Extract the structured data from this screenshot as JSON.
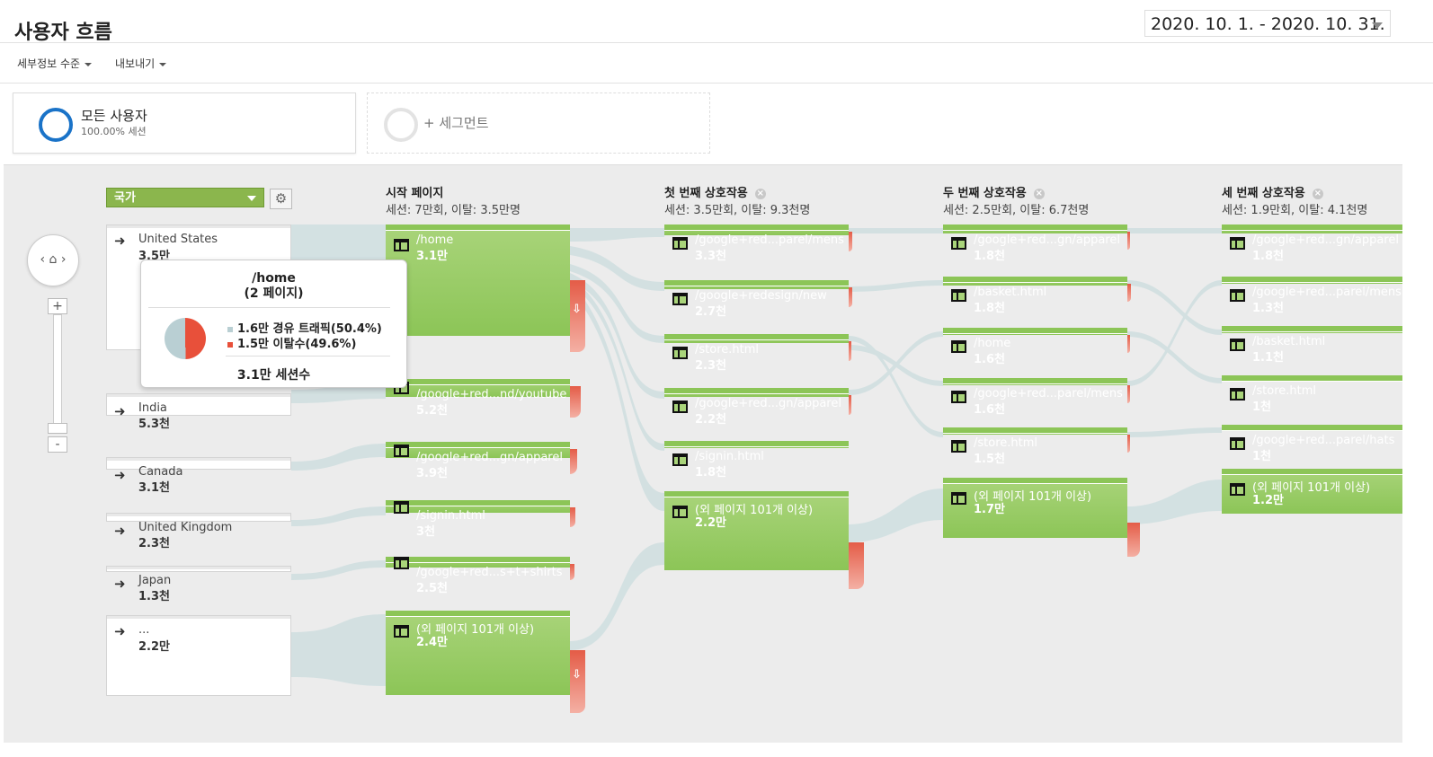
{
  "header": {
    "title": "사용자 흐름",
    "date_range": "2020. 10. 1. - 2020. 10. 31."
  },
  "toolbar": {
    "detail_level": "세부정보 수준",
    "export": "내보내기"
  },
  "segments": {
    "active": {
      "name": "모든 사용자",
      "share": "100.00% 세션",
      "color": "#1a73c8"
    },
    "add": "+ 세그먼트"
  },
  "flow": {
    "dimension": "국가",
    "columns": [
      {
        "title": "시작 페이지",
        "summary": "세션: 7만회, 이탈: 3.5만명"
      },
      {
        "title": "첫 번째 상호작용",
        "summary": "세션: 3.5만회, 이탈: 9.3천명"
      },
      {
        "title": "두 번째 상호작용",
        "summary": "세션: 2.5만회, 이탈: 6.7천명"
      },
      {
        "title": "세 번째 상호작용",
        "summary": "세션: 1.9만회, 이탈: 4.1천명"
      }
    ],
    "countries": [
      {
        "name": "United States",
        "value": "3.5만"
      },
      {
        "name": "India",
        "value": "5.3천"
      },
      {
        "name": "Canada",
        "value": "3.1천"
      },
      {
        "name": "United Kingdom",
        "value": "2.3천"
      },
      {
        "name": "Japan",
        "value": "1.3천"
      },
      {
        "name": "...",
        "value": "2.2만"
      }
    ],
    "start_pages": [
      {
        "name": "/home",
        "value": "3.1만"
      },
      {
        "name": "/google+red...nd/youtube",
        "value": "5.2천"
      },
      {
        "name": "/google+red...gn/apparel",
        "value": "3.9천"
      },
      {
        "name": "/signin.html",
        "value": "3천"
      },
      {
        "name": "/google+red...s+t+shirts",
        "value": "2.5천"
      },
      {
        "name": "(외 페이지 101개 이상)",
        "value": "2.4만"
      }
    ],
    "first_interaction": [
      {
        "name": "/google+red...parel/mens",
        "value": "3.3천"
      },
      {
        "name": "/google+redesign/new",
        "value": "2.7천"
      },
      {
        "name": "/store.html",
        "value": "2.3천"
      },
      {
        "name": "/google+red...gn/apparel",
        "value": "2.2천"
      },
      {
        "name": "/signin.html",
        "value": "1.8천"
      },
      {
        "name": "(외 페이지 101개 이상)",
        "value": "2.2만"
      }
    ],
    "second_interaction": [
      {
        "name": "/google+red...gn/apparel",
        "value": "1.8천"
      },
      {
        "name": "/basket.html",
        "value": "1.8천"
      },
      {
        "name": "/home",
        "value": "1.6천"
      },
      {
        "name": "/google+red...parel/mens",
        "value": "1.6천"
      },
      {
        "name": "/store.html",
        "value": "1.5천"
      },
      {
        "name": "(외 페이지 101개 이상)",
        "value": "1.7만"
      }
    ],
    "third_interaction": [
      {
        "name": "/google+red...gn/apparel",
        "value": "1.8천"
      },
      {
        "name": "/google+red...parel/mens",
        "value": "1.3천"
      },
      {
        "name": "/basket.html",
        "value": "1.1천"
      },
      {
        "name": "/store.html",
        "value": "1천"
      },
      {
        "name": "/google+red...parel/hats",
        "value": "1천"
      },
      {
        "name": "(외 페이지 101개 이상)",
        "value": "1.2만"
      }
    ]
  },
  "tooltip": {
    "title": "/home",
    "subtitle": "(2 페이지)",
    "through_value": "1.6만",
    "through_label": "경유 트래픽(50.4%)",
    "drop_value": "1.5만",
    "drop_label": "이탈수(49.6%)",
    "total_value": "3.1만",
    "total_label": "세션수",
    "through_share": 50.4,
    "drop_share": 49.6,
    "through_color": "#b9cfd3",
    "drop_color": "#e8503a"
  },
  "zoom": {
    "plus": "+",
    "minus": "-"
  }
}
